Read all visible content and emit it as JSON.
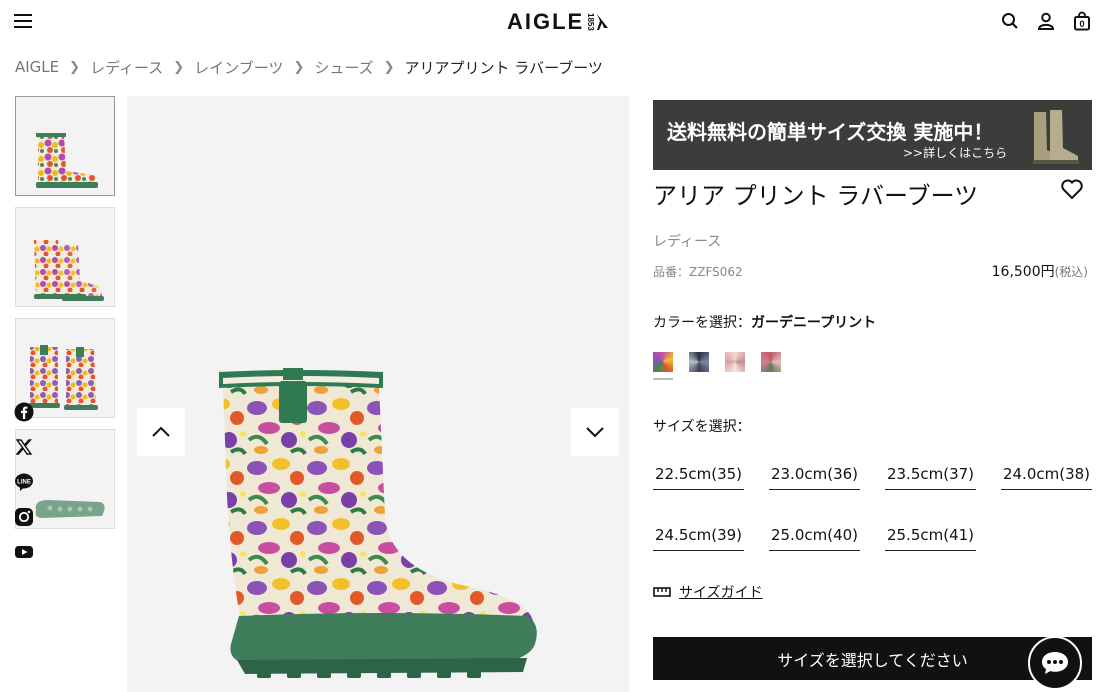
{
  "header": {
    "logo_text": "AIGLE",
    "logo_year": "1853",
    "icons": [
      "menu-icon",
      "search-icon",
      "account-icon",
      "cart-icon"
    ],
    "cart_count": "0"
  },
  "breadcrumb": [
    "AIGLE",
    "レディース",
    "レインブーツ",
    "シューズ",
    "アリアプリント ラバーブーツ"
  ],
  "social": [
    "facebook-icon",
    "x-icon",
    "line-icon",
    "instagram-icon",
    "youtube-icon"
  ],
  "social_line_label": "LINE",
  "banner": {
    "title": "送料無料の簡単サイズ交換 実施中！",
    "link": ">>詳しくはこちら"
  },
  "product": {
    "title": "アリア プリント ラバーブーツ",
    "category": "レディース",
    "sku": "品番：ZZFS062",
    "price": "16,500円",
    "tax": "(税込)",
    "color_label": "カラーを選択：",
    "color_name": "ガーデニープリント",
    "size_label": "サイズを選択：",
    "sizes": [
      "22.5cm(35)",
      "23.0cm(36)",
      "23.5cm(37)",
      "24.0cm(38)",
      "24.5cm(39)",
      "25.0cm(40)",
      "25.5cm(41)"
    ],
    "size_guide": "サイズガイド",
    "cta": "サイズを選択してください"
  },
  "colors": {
    "accent": "#111111",
    "boot_green": "#3f7d5a",
    "banner_bg": "#3a3d3a"
  }
}
